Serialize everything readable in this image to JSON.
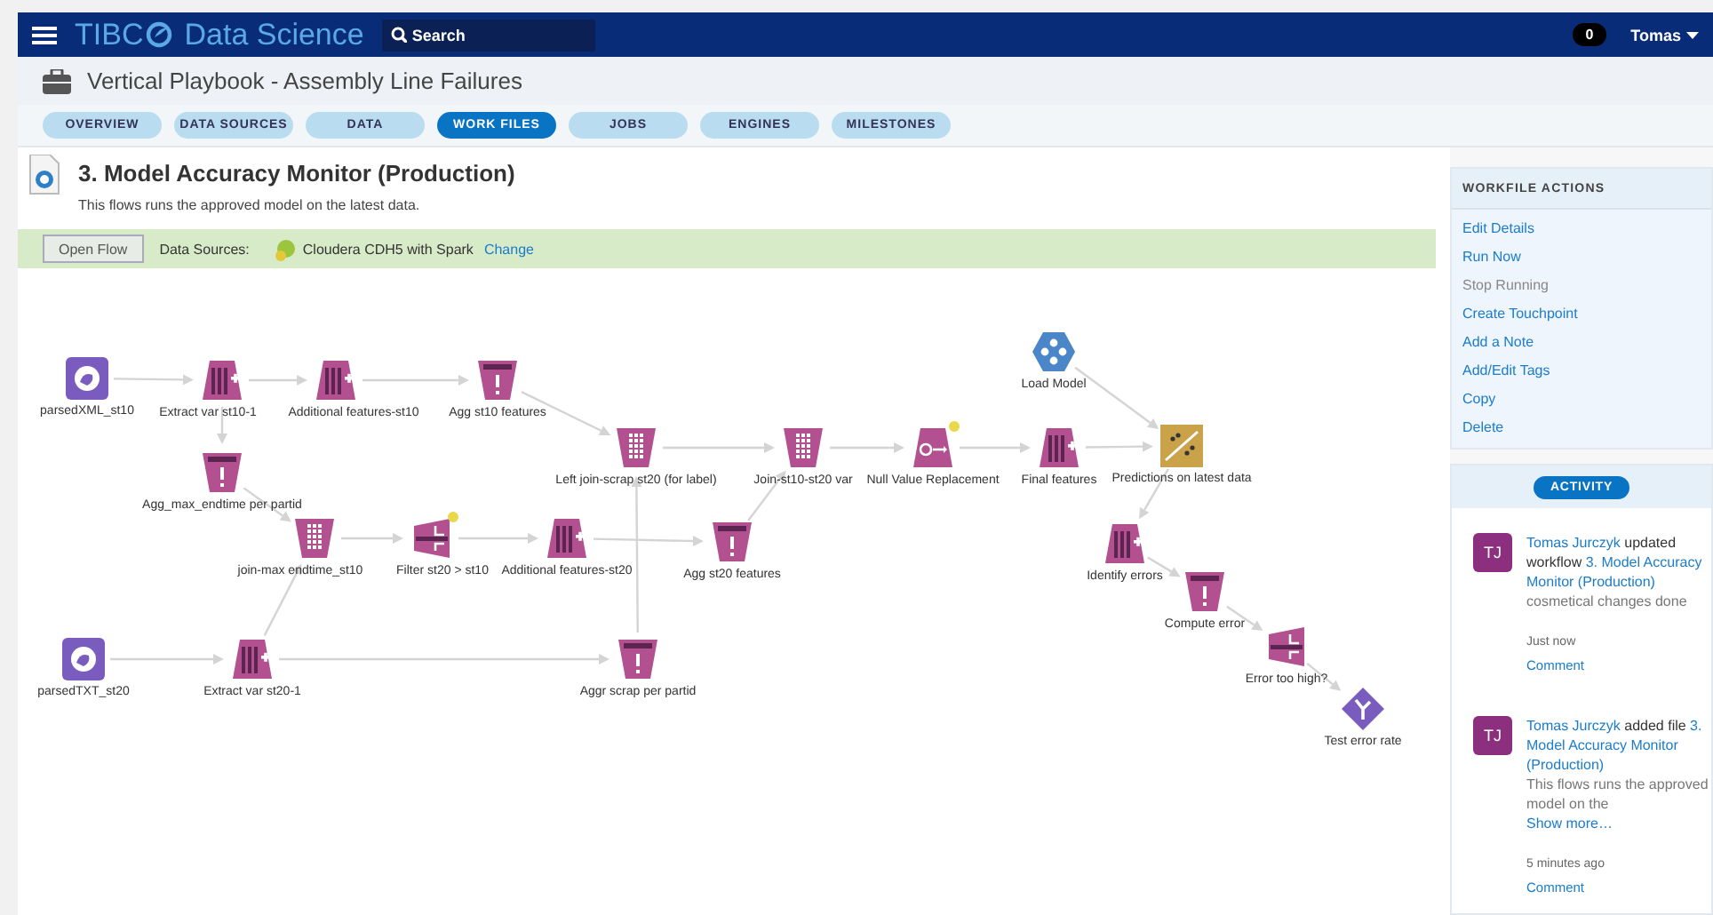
{
  "navbar": {
    "brand": "TIBC",
    "product": "Data Science",
    "search": {
      "placeholder": "Search"
    },
    "notifications": "0",
    "user": "Tomas"
  },
  "project": {
    "title": "Vertical Playbook - Assembly Line Failures"
  },
  "tabs": [
    {
      "label": "OVERVIEW",
      "selected": false
    },
    {
      "label": "DATA SOURCES",
      "selected": false
    },
    {
      "label": "DATA",
      "selected": false
    },
    {
      "label": "WORK FILES",
      "selected": true
    },
    {
      "label": "JOBS",
      "selected": false
    },
    {
      "label": "ENGINES",
      "selected": false
    },
    {
      "label": "MILESTONES",
      "selected": false
    }
  ],
  "workfile": {
    "title": "3. Model Accuracy Monitor (Production)",
    "description": "This flows runs the approved model on the latest data.",
    "open_button": "Open Flow",
    "sources_label": "Data Sources:",
    "source": "Cloudera CDH5 with Spark",
    "change_link": "Change"
  },
  "flow": {
    "nodes": [
      {
        "label": "parsedXML_st10",
        "kind": "source",
        "warning": false
      },
      {
        "label": "Extract var st10-1",
        "kind": "columns",
        "warning": false
      },
      {
        "label": "Additional features-st10",
        "kind": "columns",
        "warning": false
      },
      {
        "label": "Agg st10 features",
        "kind": "aggregate",
        "warning": false
      },
      {
        "label": "Agg_max_endtime per partid",
        "kind": "aggregate",
        "warning": false
      },
      {
        "label": "Left join-scrap st20 (for label)",
        "kind": "join",
        "warning": false
      },
      {
        "label": "join-max endtime_st10",
        "kind": "join",
        "warning": false
      },
      {
        "label": "Filter st20 > st10",
        "kind": "filter",
        "warning": true
      },
      {
        "label": "Additional features-st20",
        "kind": "columns",
        "warning": false
      },
      {
        "label": "Agg st20 features",
        "kind": "aggregate",
        "warning": false
      },
      {
        "label": "Join-st10-st20 var",
        "kind": "join",
        "warning": false
      },
      {
        "label": "Null Value Replacement",
        "kind": "replace",
        "warning": true
      },
      {
        "label": "Final features",
        "kind": "columns",
        "warning": false
      },
      {
        "label": "Load Model",
        "kind": "model",
        "warning": false
      },
      {
        "label": "Predictions on latest data",
        "kind": "predict",
        "warning": false
      },
      {
        "label": "Identify errors",
        "kind": "columns",
        "warning": false
      },
      {
        "label": "Compute error",
        "kind": "aggregate",
        "warning": false
      },
      {
        "label": "Error too high?",
        "kind": "filter",
        "warning": false
      },
      {
        "label": "Test error rate",
        "kind": "test",
        "warning": false
      },
      {
        "label": "parsedTXT_st20",
        "kind": "source",
        "warning": false
      },
      {
        "label": "Extract var st20-1",
        "kind": "columns",
        "warning": false
      },
      {
        "label": "Aggr scrap per partid",
        "kind": "aggregate",
        "warning": false
      }
    ]
  },
  "actions": {
    "heading": "WORKFILE ACTIONS",
    "items": [
      {
        "label": "Edit Details",
        "disabled": false
      },
      {
        "label": "Run Now",
        "disabled": false
      },
      {
        "label": "Stop Running",
        "disabled": true
      },
      {
        "label": "Create Touchpoint",
        "disabled": false
      },
      {
        "label": "Add a Note",
        "disabled": false
      },
      {
        "label": "Add/Edit Tags",
        "disabled": false
      },
      {
        "label": "Copy",
        "disabled": false
      },
      {
        "label": "Delete",
        "disabled": false
      }
    ]
  },
  "activity": {
    "heading": "ACTIVITY",
    "entries": [
      {
        "initials": "TJ",
        "user": "Tomas Jurczyk",
        "action": "updated workflow",
        "target": "3. Model Accuracy Monitor (Production)",
        "note": "cosmetical changes done",
        "time": "Just now",
        "comment": "Comment"
      },
      {
        "initials": "TJ",
        "user": "Tomas Jurczyk",
        "action": "added file",
        "target": "3. Model Accuracy Monitor (Production)",
        "note": "This flows runs the approved model on the",
        "more": "Show more…",
        "time": "5 minutes ago",
        "comment": "Comment"
      }
    ]
  }
}
